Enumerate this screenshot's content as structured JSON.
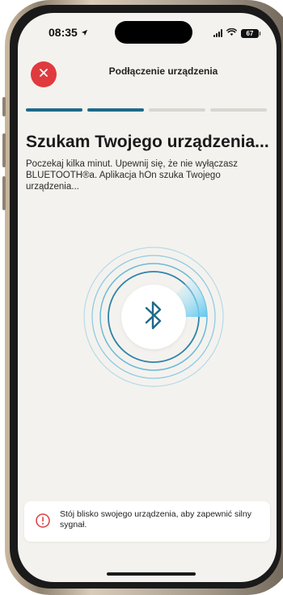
{
  "status_bar": {
    "time": "08:35",
    "battery": "67"
  },
  "header": {
    "title": "Podłączenie urządzenia"
  },
  "progress": {
    "total_steps": 4,
    "active_steps": 2
  },
  "main": {
    "heading": "Szukam Twojego urządzenia...",
    "description": "Poczekaj kilka minut. Upewnij się, że nie wyłączasz BLUETOOTH®a. Aplikacja hOn szuka Twojego urządzenia..."
  },
  "notice": {
    "text": "Stój blisko swojego urządzenia, aby zapewnić silny sygnał."
  },
  "colors": {
    "close_button": "#e03a3e",
    "progress_active": "#1e6a8a",
    "progress_inactive": "#d9d6d1",
    "bluetooth_icon": "#1e6a8a",
    "radar_sweep": "#5ec8f0",
    "warning_icon": "#e03a3e",
    "screen_background": "#f4f2ee"
  },
  "icons": {
    "close": "close-icon",
    "location": "location-arrow-icon",
    "signal": "signal-icon",
    "wifi": "wifi-icon",
    "battery": "battery-icon",
    "bluetooth": "bluetooth-icon",
    "warning": "warning-icon"
  }
}
